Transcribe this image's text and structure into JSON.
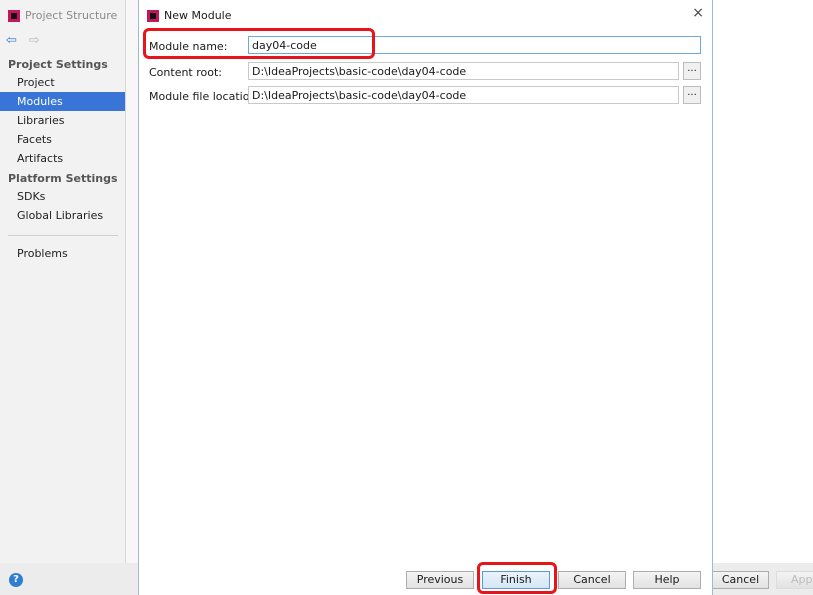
{
  "outer": {
    "title": "Project Structure",
    "back_icon": "arrow-left-icon",
    "forward_icon": "arrow-right-icon",
    "sections": [
      {
        "label": "Project Settings",
        "items": [
          "Project",
          "Modules",
          "Libraries",
          "Facets",
          "Artifacts"
        ]
      },
      {
        "label": "Platform Settings",
        "items": [
          "SDKs",
          "Global Libraries"
        ]
      }
    ],
    "problems": "Problems",
    "selected": "Modules",
    "cancel": "Cancel",
    "apply": "Apply",
    "help_icon": "?"
  },
  "dialog": {
    "title": "New Module",
    "close": "×",
    "fields": [
      {
        "label": "Module name:",
        "value": "day04-code"
      },
      {
        "label": "Content root:",
        "value": "D:\\IdeaProjects\\basic-code\\day04-code"
      },
      {
        "label": "Module file location:",
        "value": "D:\\IdeaProjects\\basic-code\\day04-code"
      }
    ],
    "browse": "...",
    "buttons": {
      "previous": "Previous",
      "finish": "Finish",
      "cancel": "Cancel",
      "help": "Help"
    }
  },
  "colors": {
    "selection": "#3875d7",
    "highlight": "#e8141c"
  }
}
